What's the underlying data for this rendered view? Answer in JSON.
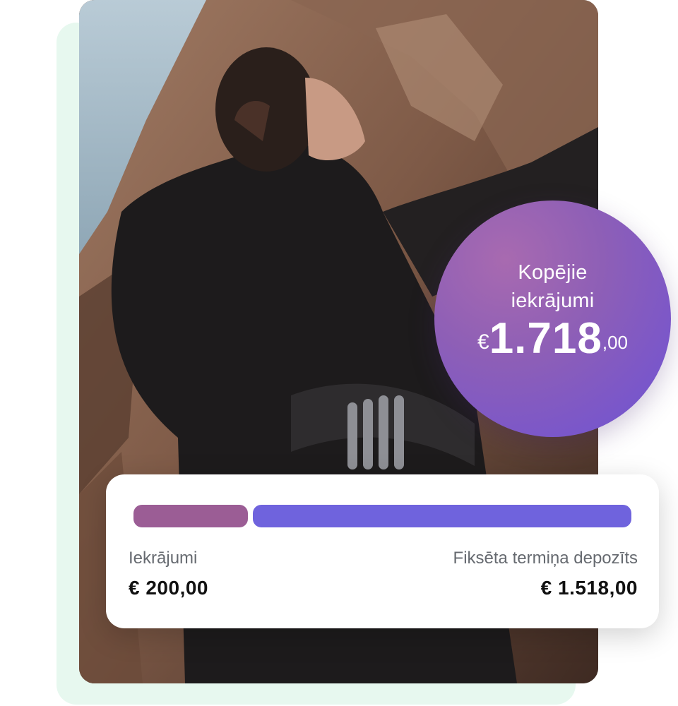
{
  "total_savings": {
    "title_line1": "Kopējie",
    "title_line2": "iekrājumi",
    "currency": "€",
    "integer_part": "1.718",
    "decimal_part": ",00"
  },
  "breakdown": {
    "savings": {
      "label": "Iekrājumi",
      "value": "€ 200,00",
      "amount": 200.0,
      "color": "#9b5d95"
    },
    "fixed_deposit": {
      "label": "Fiksēta termiņa depozīts",
      "value": "€ 1.518,00",
      "amount": 1518.0,
      "color": "#6f63dd"
    }
  },
  "colors": {
    "badge": "#8e5fb6",
    "background_panel": "#e7f8ef"
  }
}
